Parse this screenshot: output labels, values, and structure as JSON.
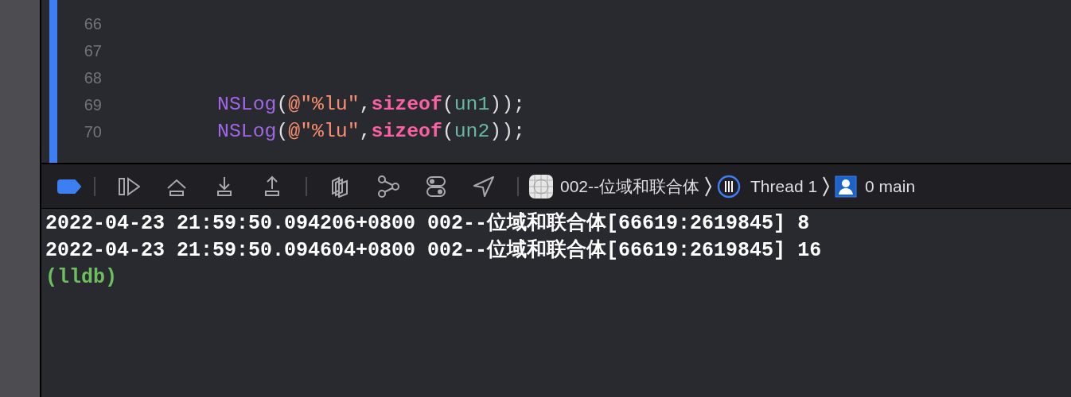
{
  "editor": {
    "lines": [
      {
        "number": "66"
      },
      {
        "number": "67"
      },
      {
        "number": "68"
      },
      {
        "number": "69",
        "tokens": [
          {
            "text": "NSLog",
            "kind": "function"
          },
          {
            "text": "(",
            "kind": "plain"
          },
          {
            "text": "@\"%lu\"",
            "kind": "string"
          },
          {
            "text": ",",
            "kind": "plain"
          },
          {
            "text": "sizeof",
            "kind": "keyword"
          },
          {
            "text": "(",
            "kind": "plain"
          },
          {
            "text": "un1",
            "kind": "variable"
          },
          {
            "text": "));",
            "kind": "plain"
          }
        ]
      },
      {
        "number": "70",
        "tokens": [
          {
            "text": "NSLog",
            "kind": "function"
          },
          {
            "text": "(",
            "kind": "plain"
          },
          {
            "text": "@\"%lu\"",
            "kind": "string"
          },
          {
            "text": ",",
            "kind": "plain"
          },
          {
            "text": "sizeof",
            "kind": "keyword"
          },
          {
            "text": "(",
            "kind": "plain"
          },
          {
            "text": "un2",
            "kind": "variable"
          },
          {
            "text": "));",
            "kind": "plain"
          }
        ]
      }
    ]
  },
  "debug_bar": {
    "breakpoints_active": true,
    "breadcrumb": [
      {
        "kind": "scheme",
        "label": "002--位域和联合体"
      },
      {
        "kind": "thread",
        "label": "Thread 1"
      },
      {
        "kind": "frame",
        "label": "0 main"
      }
    ]
  },
  "console": {
    "lines": [
      {
        "kind": "output",
        "text": "2022-04-23 21:59:50.094206+0800 002--位域和联合体[66619:2619845] 8"
      },
      {
        "kind": "output",
        "text": "2022-04-23 21:59:50.094604+0800 002--位域和联合体[66619:2619845] 16"
      },
      {
        "kind": "prompt",
        "text": "(lldb)"
      }
    ]
  }
}
